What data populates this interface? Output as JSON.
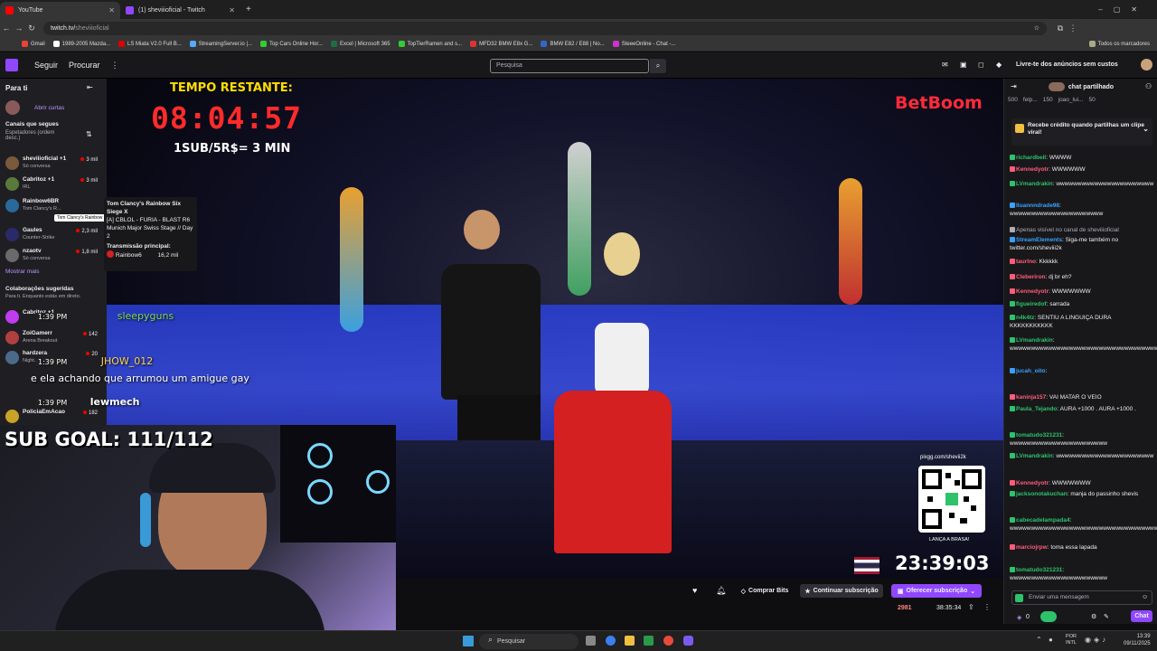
{
  "browser": {
    "tabs": [
      {
        "label": "YouTube",
        "color": "#ff0000"
      },
      {
        "label": "(1) sheviiioficial - Twitch",
        "color": "#9147ff"
      }
    ],
    "url_prefix": "twitch.tv/",
    "url_path": "sheviiioficial",
    "bookmarks": [
      "Gmail",
      "1989-2005 Mazda...",
      "LS Miata V2.0 Full B...",
      "StreamingServer.io |...",
      "Top Cars Online Hor...",
      "Excel | Microsoft 365",
      "TopTierRamen and s...",
      "MFD32 BMW E8x G...",
      "BMW E82 / E88 | No...",
      "SteeeOnline - Chat -..."
    ],
    "all_bookmarks": "Todos os marcadores"
  },
  "nav": {
    "following": "Seguir",
    "browse": "Procurar",
    "search_placeholder": "Pesquisa",
    "ad_free": "Livre-te dos anúncios sem custos"
  },
  "sidebar": {
    "title": "Para ti",
    "open_shorts": "Abrir curtas",
    "followed_heading": "Canais que segues",
    "sort": "Espetadores (ordem desc.)",
    "channels": [
      {
        "name": "sheviiioficial +1",
        "game": "Só conversa",
        "viewers": "3 mil",
        "color": "#7a5a3a"
      },
      {
        "name": "Cabritoz +1",
        "game": "IRL",
        "viewers": "3 mil",
        "color": "#5a7a3a"
      },
      {
        "name": "Rainbow6BR",
        "game": "Tom Clancy's R...",
        "viewers": "",
        "color": "#2a6a9a"
      },
      {
        "name": "Gaules",
        "game": "Counter-Strike",
        "viewers": "2,3 mil",
        "color": "#2a2a6a"
      },
      {
        "name": "nzaotv",
        "game": "Só conversa",
        "viewers": "1,8 mil",
        "color": "#6a6a6a"
      }
    ],
    "show_more": "Mostrar mais",
    "collab_heading": "Colaborações sugeridas",
    "collab_sub": "Para ti. Enquanto estás em direto.",
    "extra": [
      {
        "name": "Cabritoz +1",
        "viewers": ""
      },
      {
        "name": "ZoiGamerr",
        "game": "Arena Breakout",
        "viewers": "142"
      },
      {
        "name": "hardzera",
        "game": "Night...",
        "viewers": "20"
      },
      {
        "name": "PoliciaEmAcao",
        "viewers": "182"
      }
    ]
  },
  "tooltip": {
    "small": "Tom Clancy's Rainbow Six Siege X",
    "title": "Tom Clancy's Rainbow Six Siege X",
    "body": "[A] CBLOL - FURIA - BLAST R6 Munich Major Swiss Stage // Day 2",
    "main_label": "Transmissão principal:",
    "main_channel": "Rainbow6",
    "main_viewers": "16,2 mil"
  },
  "overlay": {
    "timer_label": "TEMPO RESTANTE:",
    "timer": "08:04:57",
    "rate": "1SUB/5R$= 3 MIN",
    "sponsor": "BetBoom",
    "qr_url": "pixgg.com/shevii2k",
    "qr_caption": "LANÇA A BRASA!",
    "clock": "23:39:03",
    "chat": [
      {
        "time": "1:39 PM",
        "user": "sleepyguns",
        "text": ""
      },
      {
        "time": "1:39 PM",
        "user": "JHOW_012",
        "text": "e ela achando que arrumou um amigue gay"
      },
      {
        "time": "1:39 PM",
        "user": "lewmech",
        "text": ""
      }
    ],
    "sub_goal": "SUB GOAL: 111/112"
  },
  "infobar": {
    "get_bits": "Comprar Bits",
    "continue_sub": "Continuar subscrição",
    "gift_sub": "Oferecer subscrição",
    "viewers": "2981",
    "uptime": "38:35:34"
  },
  "chat": {
    "header": "chat partilhado",
    "stats": [
      "500",
      "felp...",
      "150",
      "joao_lui...",
      "50"
    ],
    "viral": "Recebe crédito quando partilhas um clipe viral!",
    "messages": [
      {
        "user": "richardbell",
        "color": "#2ec26a",
        "text": "WWWW"
      },
      {
        "user": "Kennedyotr",
        "color": "#ff5c7a",
        "text": "WWWWWW"
      },
      {
        "user": "LVmandrakin",
        "color": "#2ec26a",
        "text": "wwwwwwwwwwwwwwwwwwwwwww"
      },
      {
        "user": "lluannndrade98",
        "color": "#3aa0ff",
        "text": "wwwwwwwwwwwwwwwwwwwwww"
      },
      {
        "user": "",
        "color": "#adadb8",
        "text": "Apenas visível no canal de sheviiioficial"
      },
      {
        "user": "StreamElements",
        "color": "#3aa0ff",
        "text": "Siga-me também no twitter.com/sheviii2k"
      },
      {
        "user": "taurlno",
        "color": "#ff5c7a",
        "text": "Kkkkkk"
      },
      {
        "user": "Cleberiron",
        "color": "#ff5c7a",
        "text": "dj br eh?"
      },
      {
        "user": "Kennedyotr",
        "color": "#ff5c7a",
        "text": "WWWWWWW"
      },
      {
        "user": "figueiredof",
        "color": "#2ec26a",
        "text": "sarrada"
      },
      {
        "user": "n4k4tz",
        "color": "#2ec26a",
        "text": "SENTIU A LINGUIÇA DURA KKKKKKKKKKK"
      },
      {
        "user": "LVmandrakin",
        "color": "#2ec26a",
        "text": "wwwwwwwwwwwwwwwwwwwwwwwwwwwwwwwwwwwwwwwwwwwwww"
      },
      {
        "user": "jucah_oito",
        "color": "#3aa0ff",
        "text": ""
      },
      {
        "user": "kaninja157",
        "color": "#ff5c7a",
        "text": "VAI MATAR O VEIO"
      },
      {
        "user": "Paula_Tejando",
        "color": "#2ec26a",
        "text": "AURA +1000 . AURA +1000 ."
      },
      {
        "user": "tomatudo321231",
        "color": "#2ec26a",
        "text": "wwwwwwwwwwwwwwwwwwwwwww"
      },
      {
        "user": "LVmandrakin",
        "color": "#2ec26a",
        "text": "wwwwwwwwwwwwwwwwwwwwwww"
      },
      {
        "user": "Kennedyotr",
        "color": "#ff5c7a",
        "text": "WWWWWWW"
      },
      {
        "user": "jacksonotakuchan",
        "color": "#2ec26a",
        "text": "manja do passinho shevis"
      },
      {
        "user": "cabecadelampada4",
        "color": "#2ec26a",
        "text": "wwwwwwwwwwwwwwwwwwwwwwwwwwwwwwwwwwwwwwwww"
      },
      {
        "user": "marciojrpw",
        "color": "#ff5c7a",
        "text": "toma essa lapada"
      },
      {
        "user": "tomatudo321231",
        "color": "#2ec26a",
        "text": "wwwwwwwwwwwwwwwwwwwwwww"
      }
    ],
    "input_placeholder": "Enviar uma mensagem",
    "points": "0",
    "send": "Chat"
  },
  "taskbar": {
    "search": "Pesquisar",
    "lang": "POR INTL",
    "time": "13:39",
    "date": "09/11/2025"
  }
}
